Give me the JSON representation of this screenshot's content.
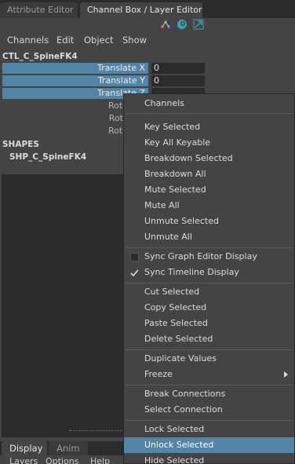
{
  "tabs": {
    "attribute_editor": "Attribute Editor",
    "channel_box": "Channel Box / Layer Editor"
  },
  "toolbar_icons": [
    "graph-editor-icon",
    "swirl-icon",
    "resize-arrow-icon"
  ],
  "menubar": {
    "channels": "Channels",
    "edit": "Edit",
    "object": "Object",
    "show": "Show"
  },
  "node_name": "CTL_C_SpineFK4",
  "attributes": [
    {
      "label": "Translate X",
      "value": "0"
    },
    {
      "label": "Translate Y",
      "value": "0"
    },
    {
      "label": "Translate Z",
      "value": ""
    },
    {
      "label": "Rotate X",
      "value": ""
    },
    {
      "label": "Rotate Y",
      "value": ""
    },
    {
      "label": "Rotate Z",
      "value": ""
    }
  ],
  "shapes_header": "SHAPES",
  "shape_name": "SHP_C_SpineFK4",
  "bottom_tabs": {
    "display": "Display",
    "anim": "Anim"
  },
  "bottom_menu": {
    "layers": "Layers",
    "options": "Options",
    "help": "Help"
  },
  "context_menu": {
    "title": "Channels",
    "items": {
      "key_selected": "Key Selected",
      "key_all_keyable": "Key All Keyable",
      "breakdown_selected": "Breakdown Selected",
      "breakdown_all": "Breakdown All",
      "mute_selected": "Mute Selected",
      "mute_all": "Mute All",
      "unmute_selected": "Unmute Selected",
      "unmute_all": "Unmute All",
      "sync_graph_editor": "Sync Graph Editor Display",
      "sync_timeline": "Sync Timeline Display",
      "cut_selected": "Cut Selected",
      "copy_selected": "Copy Selected",
      "paste_selected": "Paste Selected",
      "delete_selected": "Delete Selected",
      "duplicate_values": "Duplicate Values",
      "freeze": "Freeze",
      "break_connections": "Break Connections",
      "select_connection": "Select Connection",
      "lock_selected": "Lock Selected",
      "unlock_selected": "Unlock Selected",
      "hide_selected": "Hide Selected"
    },
    "sync_graph_editor_checked": false,
    "sync_timeline_checked": true,
    "highlighted_item": "Unlock Selected"
  },
  "colors": {
    "selection": "#5285a6",
    "panel": "#444444",
    "dark": "#2b2b2b"
  }
}
